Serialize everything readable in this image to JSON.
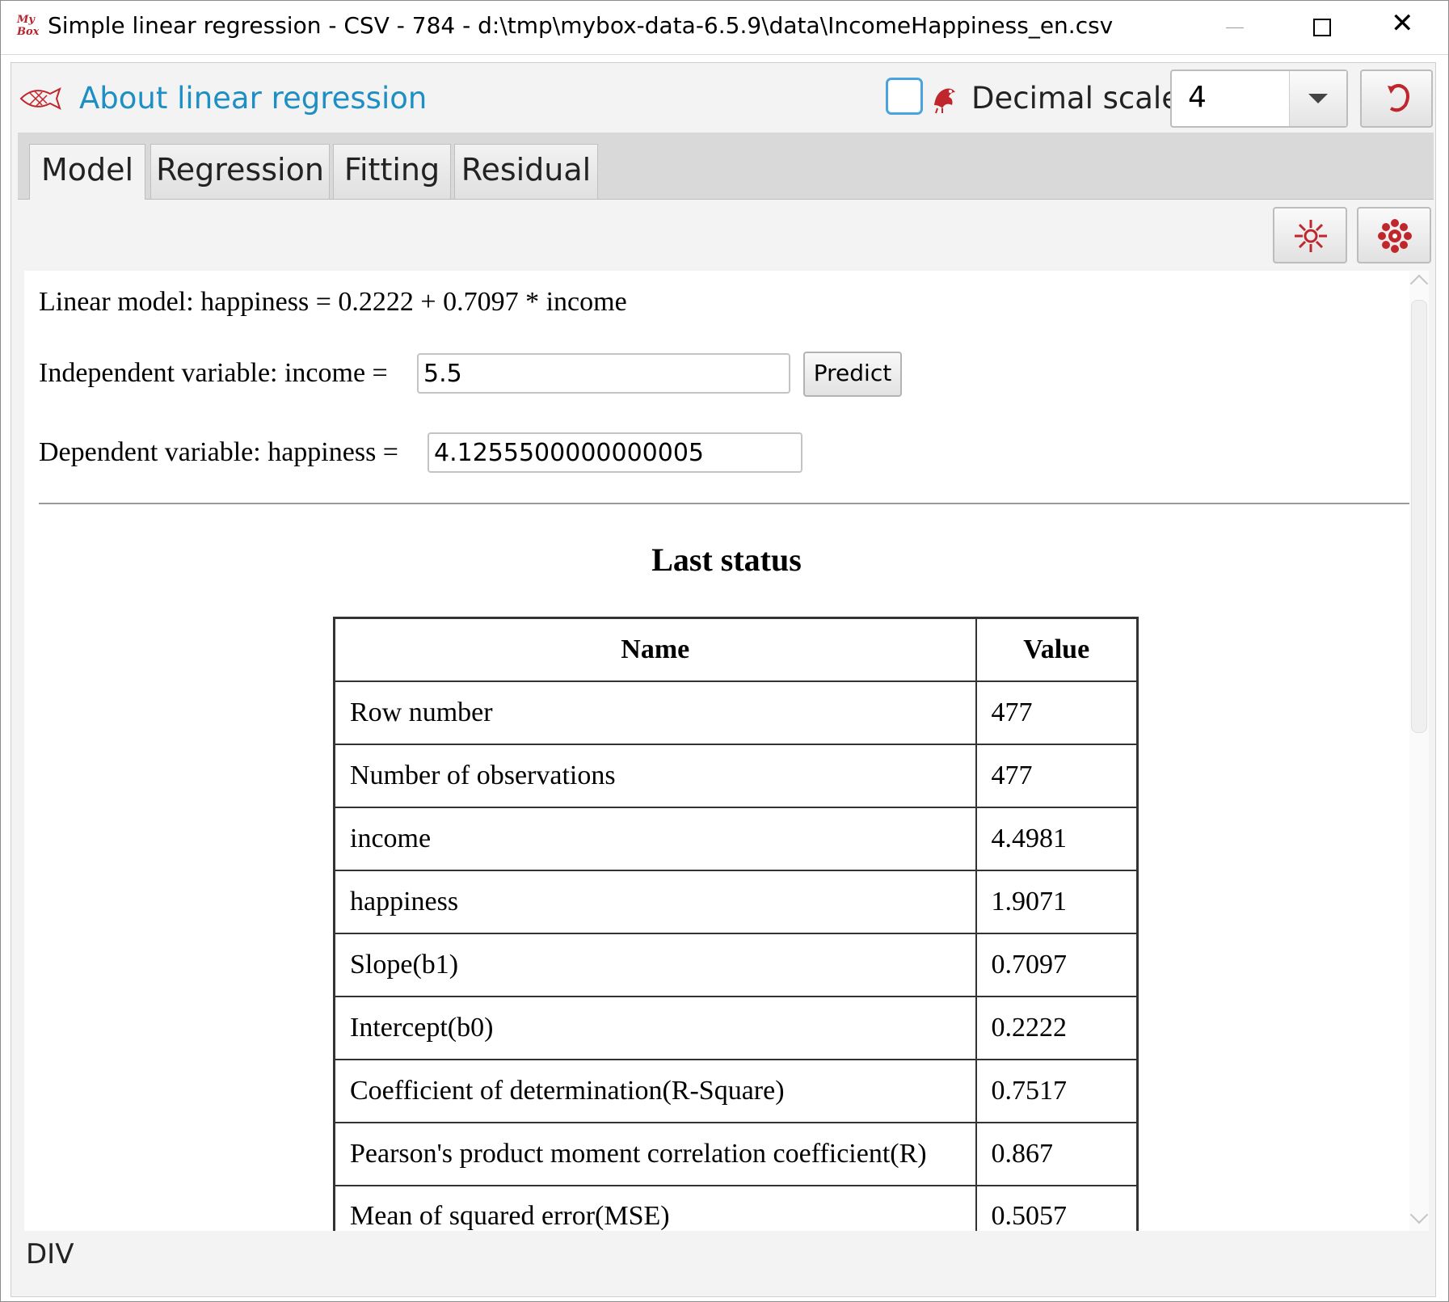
{
  "window": {
    "logo_text": "My Box",
    "title": "Simple linear regression - CSV - 784 - d:\\tmp\\mybox-data-6.5.9\\data\\IncomeHappiness_en.csv"
  },
  "toolbar": {
    "about_link": "About linear regression",
    "decimal_label": "Decimal scale",
    "decimal_value": "4"
  },
  "tabs": [
    {
      "label": "Model",
      "active": true
    },
    {
      "label": "Regression",
      "active": false
    },
    {
      "label": "Fitting",
      "active": false
    },
    {
      "label": "Residual",
      "active": false
    }
  ],
  "model": {
    "equation": "Linear model: happiness = 0.2222 + 0.7097 * income",
    "independent_label": "Independent variable: income =",
    "independent_value": "5.5",
    "predict_label": "Predict",
    "dependent_label": "Dependent variable: happiness =",
    "dependent_value": "4.1255500000000005"
  },
  "status": {
    "heading": "Last status",
    "columns": [
      "Name",
      "Value"
    ],
    "rows": [
      {
        "name": "Row number",
        "value": "477"
      },
      {
        "name": "Number of observations",
        "value": "477"
      },
      {
        "name": "income",
        "value": "4.4981"
      },
      {
        "name": "happiness",
        "value": "1.9071"
      },
      {
        "name": "Slope(b1)",
        "value": "0.7097"
      },
      {
        "name": "Intercept(b0)",
        "value": "0.2222"
      },
      {
        "name": "Coefficient of determination(R-Square)",
        "value": "0.7517"
      },
      {
        "name": "Pearson's product moment correlation coefficient(R)",
        "value": "0.867"
      },
      {
        "name": "Mean of squared error(MSE)",
        "value": "0.5057"
      }
    ]
  },
  "footer": {
    "label": "DIV"
  },
  "colors": {
    "accent_link": "#1d8fc4",
    "icon_red": "#c0272d",
    "checkbox_border": "#4aa3df"
  },
  "icons": [
    "app-logo-icon",
    "fish-icon",
    "bird-icon",
    "refresh-icon",
    "flower-outline-icon",
    "flower-filled-icon",
    "minimize-icon",
    "maximize-icon",
    "close-icon"
  ]
}
